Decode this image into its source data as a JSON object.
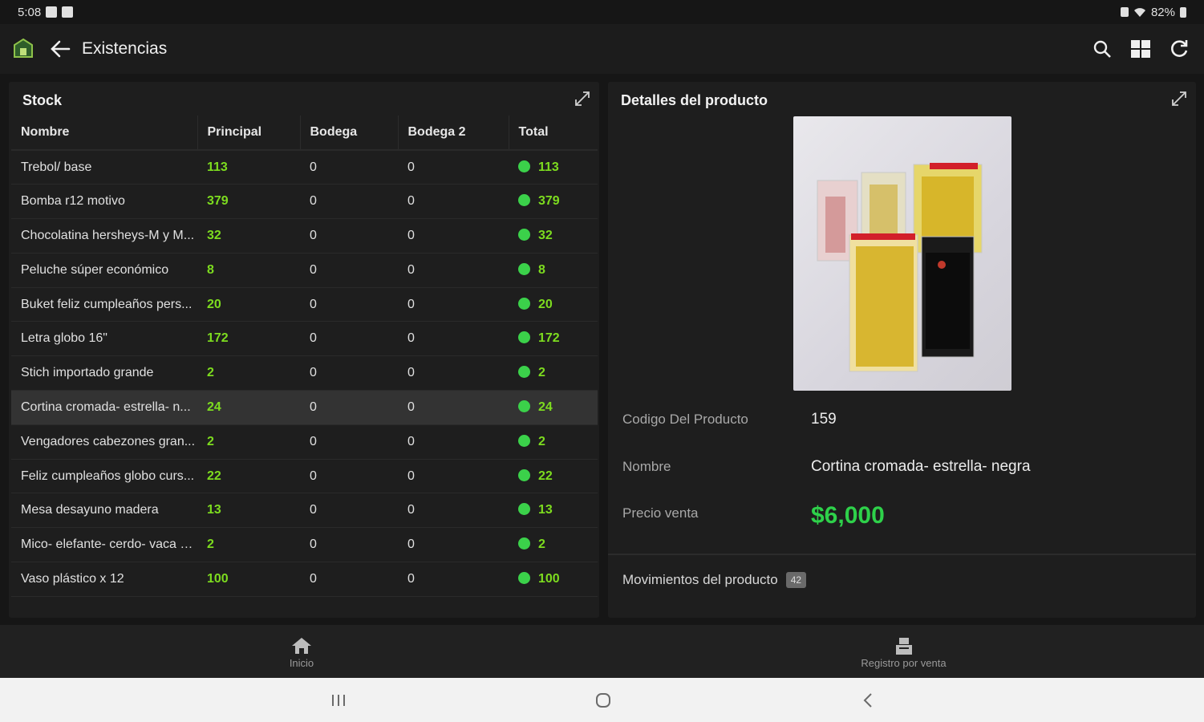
{
  "status": {
    "time": "5:08",
    "battery": "82%"
  },
  "appbar": {
    "title": "Existencias"
  },
  "stock": {
    "title": "Stock",
    "columns": [
      "Nombre",
      "Principal",
      "Bodega",
      "Bodega 2",
      "Total"
    ],
    "rows": [
      {
        "nombre": "Trebol/ base",
        "principal": "113",
        "bodega": "0",
        "bodega2": "0",
        "total": "113"
      },
      {
        "nombre": "Bomba r12 motivo",
        "principal": "379",
        "bodega": "0",
        "bodega2": "0",
        "total": "379"
      },
      {
        "nombre": "Chocolatina hersheys-M y M...",
        "principal": "32",
        "bodega": "0",
        "bodega2": "0",
        "total": "32"
      },
      {
        "nombre": "Peluche súper económico",
        "principal": "8",
        "bodega": "0",
        "bodega2": "0",
        "total": "8"
      },
      {
        "nombre": "Buket feliz cumpleaños pers...",
        "principal": "20",
        "bodega": "0",
        "bodega2": "0",
        "total": "20"
      },
      {
        "nombre": "Letra globo 16\"",
        "principal": "172",
        "bodega": "0",
        "bodega2": "0",
        "total": "172"
      },
      {
        "nombre": "Stich importado grande",
        "principal": "2",
        "bodega": "0",
        "bodega2": "0",
        "total": "2"
      },
      {
        "nombre": "Cortina cromada- estrella- n...",
        "principal": "24",
        "bodega": "0",
        "bodega2": "0",
        "total": "24"
      },
      {
        "nombre": "Vengadores cabezones gran...",
        "principal": "2",
        "bodega": "0",
        "bodega2": "0",
        "total": "2"
      },
      {
        "nombre": "Feliz cumpleaños globo curs...",
        "principal": "22",
        "bodega": "0",
        "bodega2": "0",
        "total": "22"
      },
      {
        "nombre": "Mesa desayuno madera",
        "principal": "13",
        "bodega": "0",
        "bodega2": "0",
        "total": "13"
      },
      {
        "nombre": "Mico- elefante- cerdo- vaca p...",
        "principal": "2",
        "bodega": "0",
        "bodega2": "0",
        "total": "2"
      },
      {
        "nombre": "Vaso plástico x 12",
        "principal": "100",
        "bodega": "0",
        "bodega2": "0",
        "total": "100"
      }
    ]
  },
  "details": {
    "title": "Detalles del producto",
    "codigo_label": "Codigo Del Producto",
    "codigo_value": "159",
    "nombre_label": "Nombre",
    "nombre_value": "Cortina cromada- estrella- negra",
    "precio_label": "Precio venta",
    "precio_value": "$6,000",
    "movimientos_label": "Movimientos del producto",
    "movimientos_count": "42"
  },
  "bottomnav": {
    "home_label": "Inicio",
    "register_label": "Registro por venta"
  },
  "colors": {
    "accent_green": "#2ed14a",
    "stock_green": "#7ddc1f",
    "bg": "#161616",
    "panel": "#1e1e1e"
  }
}
